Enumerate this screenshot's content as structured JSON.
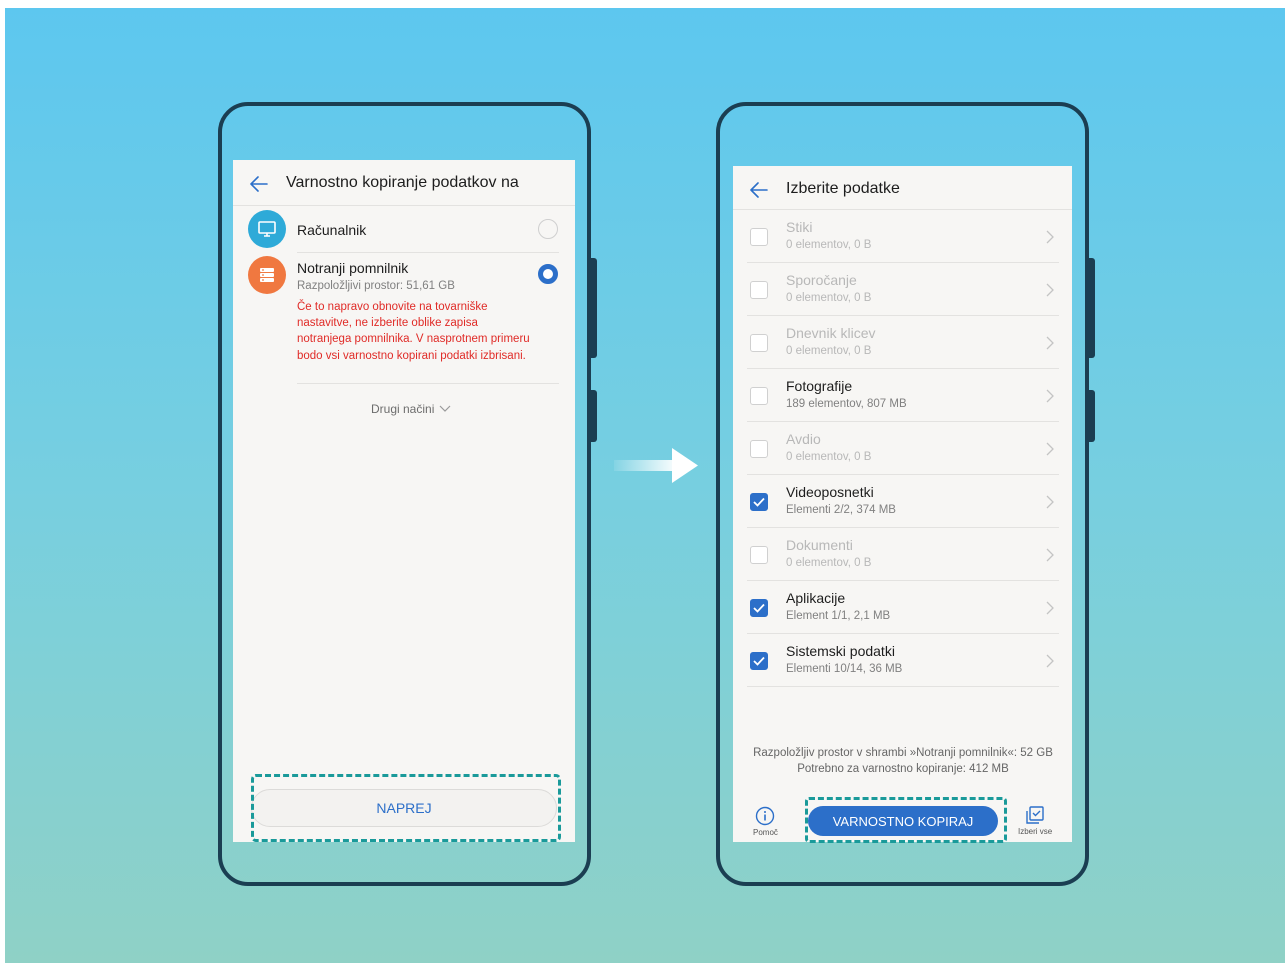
{
  "left_screen": {
    "title": "Varnostno kopiranje podatkov na",
    "options": [
      {
        "title": "Računalnik",
        "icon": "computer-icon",
        "color": "#2eaad8",
        "selected": false
      },
      {
        "title": "Notranji pomnilnik",
        "subtitle": "Razpoložljivi prostor: 51,61 GB",
        "icon": "storage-icon",
        "color": "#f07840",
        "selected": true
      }
    ],
    "warning": "Če to napravo obnovite na tovarniške nastavitve, ne izberite oblike zapisa notranjega pomnilnika. V nasprotnem primeru bodo vsi varnostno kopirani podatki izbrisani.",
    "more_options": "Drugi načini",
    "next_button": "NAPREJ"
  },
  "right_screen": {
    "title": "Izberite podatke",
    "items": [
      {
        "title": "Stiki",
        "subtitle": "0 elementov, 0 B",
        "checked": false,
        "enabled": false
      },
      {
        "title": "Sporočanje",
        "subtitle": "0 elementov, 0 B",
        "checked": false,
        "enabled": false
      },
      {
        "title": "Dnevnik klicev",
        "subtitle": "0 elementov, 0 B",
        "checked": false,
        "enabled": false
      },
      {
        "title": "Fotografije",
        "subtitle": "189 elementov, 807 MB",
        "checked": false,
        "enabled": true
      },
      {
        "title": "Avdio",
        "subtitle": "0 elementov, 0 B",
        "checked": false,
        "enabled": false
      },
      {
        "title": "Videoposnetki",
        "subtitle": "Elementi 2/2, 374 MB",
        "checked": true,
        "enabled": true
      },
      {
        "title": "Dokumenti",
        "subtitle": "0 elementov, 0 B",
        "checked": false,
        "enabled": false
      },
      {
        "title": "Aplikacije",
        "subtitle": "Element 1/1, 2,1 MB",
        "checked": true,
        "enabled": true
      },
      {
        "title": "Sistemski podatki",
        "subtitle": "Elementi 10/14, 36 MB",
        "checked": true,
        "enabled": true
      }
    ],
    "storage_available": "Razpoložljiv prostor v shrambi »Notranji pomnilnik«: 52 GB",
    "storage_required": "Potrebno za varnostno kopiranje: 412 MB",
    "help_label": "Pomoč",
    "backup_button": "VARNOSTNO KOPIRAJ",
    "select_all_label": "Izberi vse"
  },
  "colors": {
    "accent": "#2c6fc9",
    "warning": "#e02b27",
    "highlight_dash": "#1a9a9a",
    "phone_frame": "#1b3e52"
  }
}
